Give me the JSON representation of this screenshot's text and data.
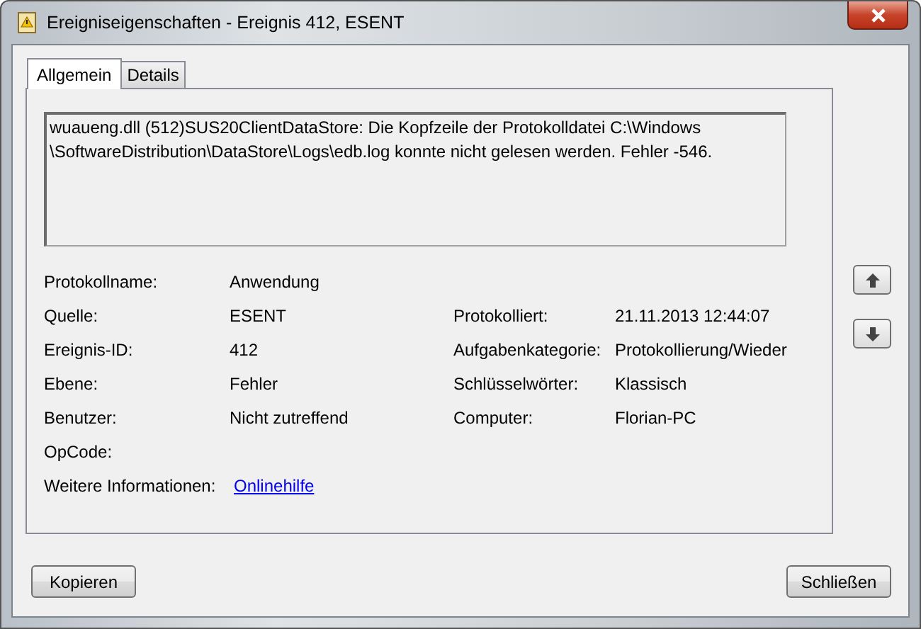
{
  "window": {
    "title": "Ereigniseigenschaften - Ereignis 412, ESENT"
  },
  "tabs": [
    {
      "label": "Allgemein",
      "selected": true
    },
    {
      "label": "Details",
      "selected": false
    }
  ],
  "message": "wuaueng.dll (512)SUS20ClientDataStore: Die Kopfzeile der Protokolldatei C:\\Windows\n\\SoftwareDistribution\\DataStore\\Logs\\edb.log konnte nicht gelesen werden. Fehler -546.",
  "properties": [
    {
      "label": "Protokollname:",
      "value": "Anwendung",
      "kind": "text"
    },
    {
      "label": "Quelle:",
      "value": "ESENT",
      "kind": "text",
      "label_2": "Protokolliert:",
      "value_2": "21.11.2013 12:44:07"
    },
    {
      "label": "Ereignis-ID:",
      "value": "412",
      "kind": "text",
      "label_2": "Aufgabenkategorie:",
      "value_2": "Protokollierung/Wieder"
    },
    {
      "label": "Ebene:",
      "value": "Fehler",
      "kind": "text",
      "label_2": "Schlüsselwörter:",
      "value_2": "Klassisch"
    },
    {
      "label": "Benutzer:",
      "value": "Nicht zutreffend",
      "kind": "text",
      "label_2": "Computer:",
      "value_2": "Florian-PC"
    },
    {
      "label": "OpCode:"
    },
    {
      "label": "Weitere Informationen:",
      "value": "Onlinehilfe",
      "kind": "link"
    }
  ],
  "buttons": [
    {
      "label": "Kopieren"
    },
    {
      "label": "Schließen"
    }
  ]
}
